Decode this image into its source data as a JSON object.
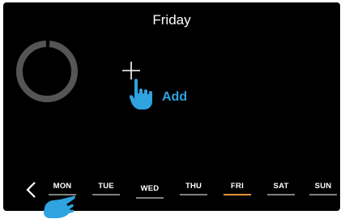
{
  "header": {
    "title": "Friday"
  },
  "progress_ring": {
    "value": 0.98,
    "track_color": "#555555"
  },
  "add_action": {
    "label": "Add",
    "icon": "plus-icon",
    "accent_color": "#2ea3e0"
  },
  "nav": {
    "back_icon": "chevron-left-icon"
  },
  "days": [
    {
      "label": "MON",
      "active": false
    },
    {
      "label": "TUE",
      "active": false
    },
    {
      "label": "WED",
      "active": false
    },
    {
      "label": "THU",
      "active": false
    },
    {
      "label": "FRI",
      "active": true
    },
    {
      "label": "SAT",
      "active": false
    },
    {
      "label": "SUN",
      "active": false
    }
  ],
  "colors": {
    "background": "#000000",
    "active_day": "#e6913a",
    "inactive_day": "#7f7f7f"
  }
}
